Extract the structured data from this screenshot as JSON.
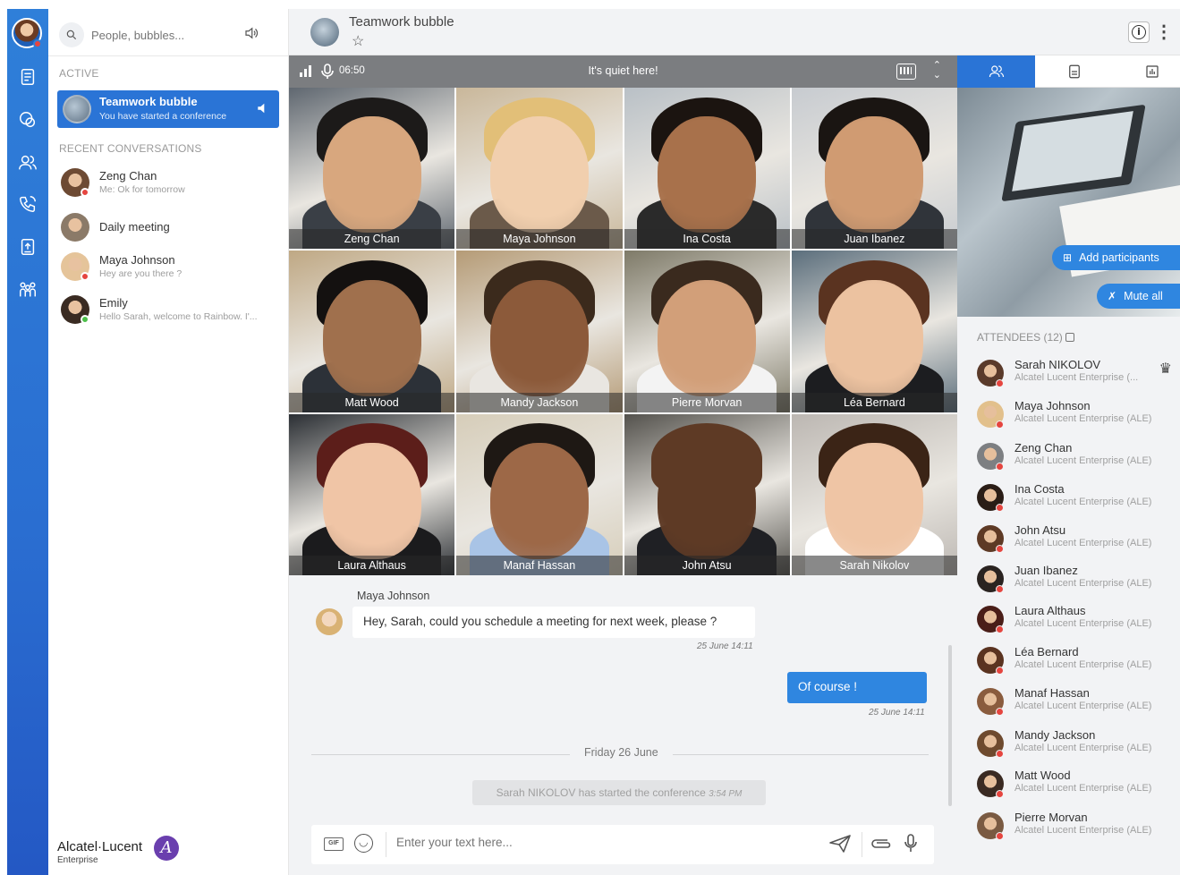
{
  "search": {
    "placeholder": "People, bubbles..."
  },
  "sections": {
    "active": "ACTIVE",
    "recent": "RECENT CONVERSATIONS"
  },
  "active_conversation": {
    "title": "Teamwork bubble",
    "subtitle": "You have started a conference"
  },
  "recent_conversations": [
    {
      "name": "Zeng Chan",
      "last": "Me: Ok for tomorrow",
      "presence_color": "#e5453f",
      "avatar_color": "#6d4a33"
    },
    {
      "name": "Daily meeting",
      "last": "",
      "presence_color": "",
      "avatar_color": "#8b7a68"
    },
    {
      "name": "Maya Johnson",
      "last": "Hey are you there ?",
      "presence_color": "#e5453f",
      "avatar_color": "#e5c49a"
    },
    {
      "name": "Emily",
      "last": "Hello Sarah, welcome to Rainbow. I'...",
      "presence_color": "#4cbf4a",
      "avatar_color": "#3a2b22"
    }
  ],
  "brand": {
    "name": "Alcatel·Lucent",
    "sub": "Enterprise",
    "logo_letter": "A"
  },
  "header": {
    "title": "Teamwork bubble",
    "star": "☆",
    "info": "i",
    "more": "⋮"
  },
  "conference": {
    "duration": "06:50",
    "status": "It's quiet here!"
  },
  "video_tiles": [
    {
      "name": "Zeng Chan",
      "bg": "#5f6770",
      "skin": "#d8a77e",
      "hair": "#1c1a19",
      "clothes": "#3a3f46"
    },
    {
      "name": "Maya Johnson",
      "bg": "#c9b79a",
      "skin": "#f1cfae",
      "hair": "#e2bf78",
      "clothes": "#6b5a4a"
    },
    {
      "name": "Ina Costa",
      "bg": "#b9c0c6",
      "skin": "#a8714b",
      "hair": "#1b1410",
      "clothes": "#2a2a2a"
    },
    {
      "name": "Juan Ibanez",
      "bg": "#c7cbd0",
      "skin": "#d09b72",
      "hair": "#1a1512",
      "clothes": "#30343a"
    },
    {
      "name": "Matt Wood",
      "bg": "#bfa884",
      "skin": "#a0704d",
      "hair": "#141110",
      "clothes": "#2c3138"
    },
    {
      "name": "Mandy Jackson",
      "bg": "#b59b76",
      "skin": "#8c5a3a",
      "hair": "#3b2a1c",
      "clothes": "#e9e6e1"
    },
    {
      "name": "Pierre Morvan",
      "bg": "#7e7a68",
      "skin": "#d29f79",
      "hair": "#3a2a1e",
      "clothes": "#f3f3f3"
    },
    {
      "name": "Léa Bernard",
      "bg": "#5b6e7c",
      "skin": "#ecc2a0",
      "hair": "#5a3320",
      "clothes": "#1c1d20"
    },
    {
      "name": "Laura Althaus",
      "bg": "#2b2f34",
      "skin": "#f0c5a6",
      "hair": "#5c1e1a",
      "clothes": "#1b1b1d"
    },
    {
      "name": "Manaf Hassan",
      "bg": "#d6cdb9",
      "skin": "#9d6847",
      "hair": "#1e1814",
      "clothes": "#a9c4e6"
    },
    {
      "name": "John Atsu",
      "bg": "#54524d",
      "skin": "#5e3a25",
      "hair": "#5e3a25",
      "clothes": "#1f2024"
    },
    {
      "name": "Sarah Nikolov",
      "bg": "#bcb7b2",
      "skin": "#efc5a5",
      "hair": "#3b2416",
      "clothes": "#ffffff"
    }
  ],
  "chat": {
    "incoming": {
      "sender": "Maya Johnson",
      "text": "Hey, Sarah, could you schedule a meeting for next week, please ?",
      "time": "25 June 14:11"
    },
    "outgoing": {
      "text": "Of course !",
      "time": "25 June 14:11"
    },
    "day": "Friday 26 June",
    "event": {
      "text": "Sarah NIKOLOV has started the conference",
      "time": "3:54 PM"
    },
    "composer_placeholder": "Enter your text here...",
    "gif_label": "GIF"
  },
  "right_panel": {
    "add_participants": "Add participants",
    "mute_all": "Mute all",
    "attendees_title": "ATTENDEES (12)",
    "attendees": [
      {
        "name": "Sarah NIKOLOV",
        "company": "Alcatel Lucent Enterprise (...",
        "avatar_color": "#5a3a2a",
        "owner": true
      },
      {
        "name": "Maya Johnson",
        "company": "Alcatel Lucent Enterprise (ALE)",
        "avatar_color": "#e2c08c",
        "owner": false
      },
      {
        "name": "Zeng Chan",
        "company": "Alcatel Lucent Enterprise (ALE)",
        "avatar_color": "#7d7f82",
        "owner": false
      },
      {
        "name": "Ina Costa",
        "company": "Alcatel Lucent Enterprise (ALE)",
        "avatar_color": "#2a1d16",
        "owner": false
      },
      {
        "name": "John Atsu",
        "company": "Alcatel Lucent Enterprise (ALE)",
        "avatar_color": "#5e3a25",
        "owner": false
      },
      {
        "name": "Juan Ibanez",
        "company": "Alcatel Lucent Enterprise (ALE)",
        "avatar_color": "#2a2320",
        "owner": false
      },
      {
        "name": "Laura Althaus",
        "company": "Alcatel Lucent Enterprise (ALE)",
        "avatar_color": "#4a1e18",
        "owner": false
      },
      {
        "name": "Léa Bernard",
        "company": "Alcatel Lucent Enterprise (ALE)",
        "avatar_color": "#5a3320",
        "owner": false
      },
      {
        "name": "Manaf Hassan",
        "company": "Alcatel Lucent Enterprise (ALE)",
        "avatar_color": "#8a5c3e",
        "owner": false
      },
      {
        "name": "Mandy Jackson",
        "company": "Alcatel Lucent Enterprise (ALE)",
        "avatar_color": "#6e4a2e",
        "owner": false
      },
      {
        "name": "Matt Wood",
        "company": "Alcatel Lucent Enterprise (ALE)",
        "avatar_color": "#3a2a22",
        "owner": false
      },
      {
        "name": "Pierre Morvan",
        "company": "Alcatel Lucent Enterprise (ALE)",
        "avatar_color": "#7a5a42",
        "owner": false
      }
    ]
  },
  "colors": {
    "accent": "#2a74d6",
    "rail": "#2f7fd9",
    "busy": "#e5453f",
    "online": "#4cbf4a"
  }
}
